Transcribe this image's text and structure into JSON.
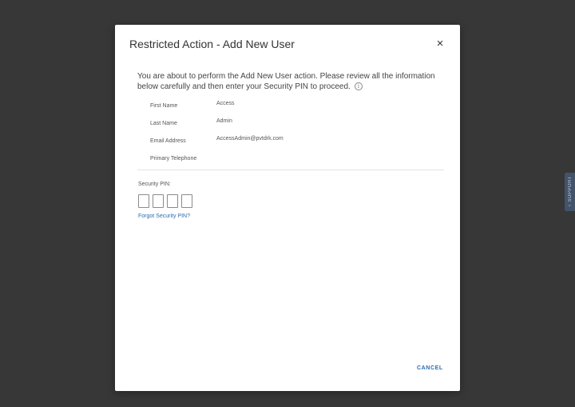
{
  "support": {
    "label": "SUPPORT",
    "icon": "chevron-up-icon"
  },
  "modal": {
    "title": "Restricted Action - Add New User",
    "close_glyph": "×",
    "intro": "You are about to perform the Add New User action. Please review all the information below carefully and then enter your Security PIN to proceed.",
    "info_glyph": "i",
    "fields": [
      {
        "label": "First Name",
        "value": "Access"
      },
      {
        "label": "Last Name",
        "value": "Admin"
      },
      {
        "label": "Email Address",
        "value": "AccessAdmin@pvtdrk.com"
      },
      {
        "label": "Primary Telephone",
        "value": ""
      }
    ],
    "pin_label": "Security PIN:",
    "pin_digits": [
      "",
      "",
      "",
      ""
    ],
    "forgot_pin_label": "Forgot Security PIN?",
    "cancel_label": "CANCEL"
  },
  "colors": {
    "link": "#2b6cb0",
    "overlay": "#373737"
  }
}
